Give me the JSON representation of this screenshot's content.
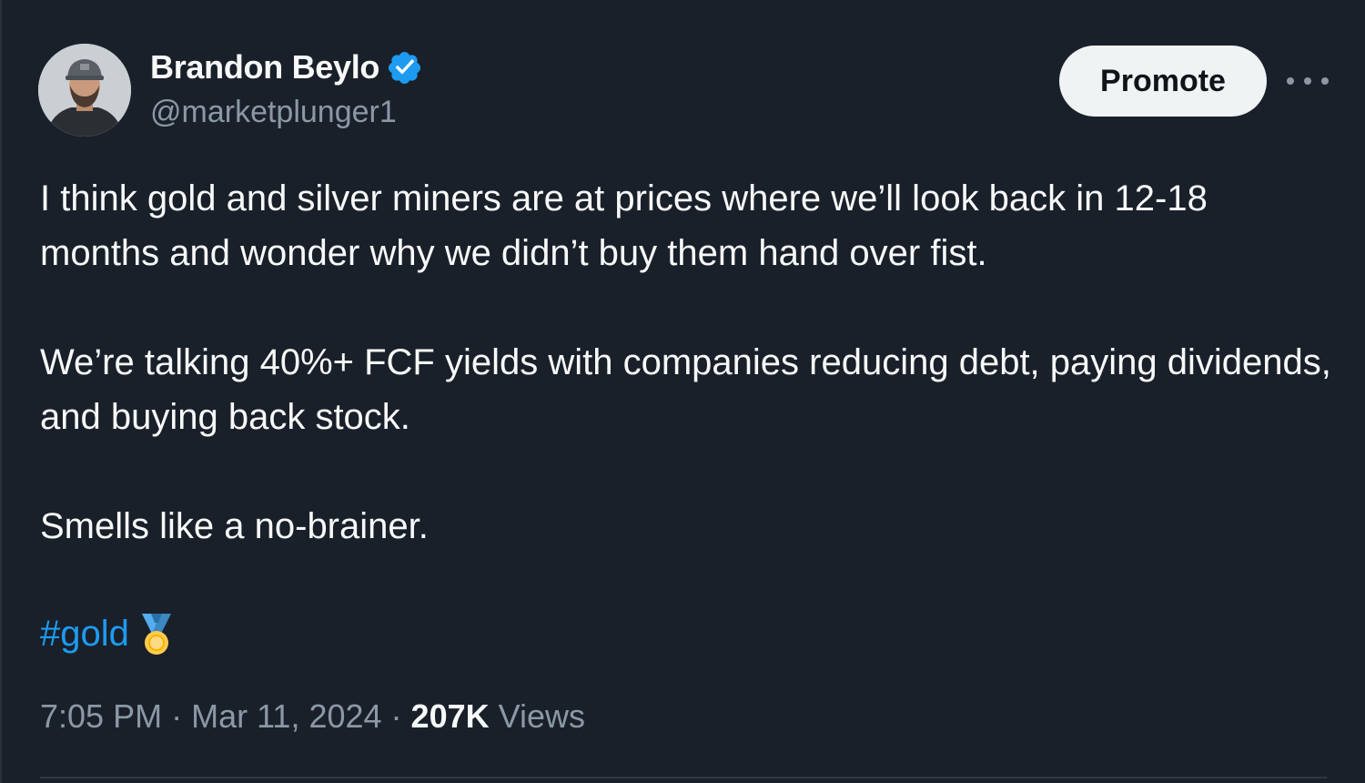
{
  "author": {
    "display_name": "Brandon Beylo",
    "handle": "@marketplunger1",
    "verified": true,
    "verified_icon": "verified-badge-icon",
    "avatar": "profile-photo"
  },
  "actions": {
    "promote_label": "Promote",
    "more_icon": "more-options-icon"
  },
  "tweet": {
    "paragraphs": [
      "I think gold and silver miners are at prices where we’ll look back in 12-18 months and wonder why we didn’t buy them hand over fist.",
      "We’re talking 40%+ FCF yields with companies reducing debt, paying dividends, and buying back stock.",
      "Smells like a no-brainer."
    ],
    "hashtag": "#gold",
    "emoji": "medal-icon"
  },
  "meta": {
    "time": "7:05 PM",
    "separator": "·",
    "date": "Mar 11, 2024",
    "views_count": "207K",
    "views_label": "Views"
  },
  "colors": {
    "background": "#1a202a",
    "text_primary": "#f7f9f9",
    "text_secondary": "#8b98a5",
    "accent": "#1d9bf0",
    "promote_bg": "#eff3f4"
  }
}
